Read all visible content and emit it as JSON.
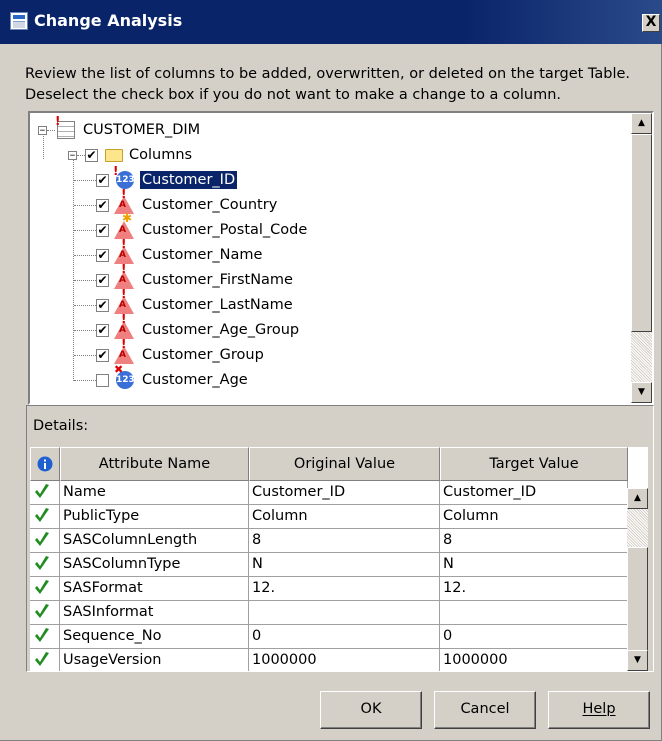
{
  "window": {
    "title": "Change Analysis",
    "close_glyph": "X"
  },
  "description": "Review the list of columns to be added, overwritten, or deleted on the target Table.  Deselect the check box if you do not want to make a change to a column.",
  "tree": {
    "root_label": "CUSTOMER_DIM",
    "folder_label": "Columns",
    "columns": [
      {
        "name": "Customer_ID",
        "checked": true,
        "icon": "numeric-column-icon",
        "badge": "modified",
        "selected": true
      },
      {
        "name": "Customer_Country",
        "checked": true,
        "icon": "character-column-icon",
        "badge": "modified",
        "selected": false
      },
      {
        "name": "Customer_Postal_Code",
        "checked": true,
        "icon": "character-column-icon",
        "badge": "added",
        "selected": false
      },
      {
        "name": "Customer_Name",
        "checked": true,
        "icon": "character-column-icon",
        "badge": "modified",
        "selected": false
      },
      {
        "name": "Customer_FirstName",
        "checked": true,
        "icon": "character-column-icon",
        "badge": "modified",
        "selected": false
      },
      {
        "name": "Customer_LastName",
        "checked": true,
        "icon": "character-column-icon",
        "badge": "modified",
        "selected": false
      },
      {
        "name": "Customer_Age_Group",
        "checked": true,
        "icon": "character-column-icon",
        "badge": "modified",
        "selected": false
      },
      {
        "name": "Customer_Group",
        "checked": true,
        "icon": "character-column-icon",
        "badge": "modified",
        "selected": false
      },
      {
        "name": "Customer_Age",
        "checked": false,
        "icon": "numeric-column-icon",
        "badge": "deleted",
        "selected": false
      }
    ]
  },
  "details": {
    "label": "Details:",
    "headers": {
      "attribute": "Attribute Name",
      "original": "Original Value",
      "target": "Target Value"
    },
    "rows": [
      {
        "attribute": "Name",
        "original": "Customer_ID",
        "target": "Customer_ID"
      },
      {
        "attribute": "PublicType",
        "original": "Column",
        "target": "Column"
      },
      {
        "attribute": "SASColumnLength",
        "original": "8",
        "target": "8"
      },
      {
        "attribute": "SASColumnType",
        "original": "N",
        "target": "N"
      },
      {
        "attribute": "SASFormat",
        "original": "12.",
        "target": "12."
      },
      {
        "attribute": "SASInformat",
        "original": "",
        "target": ""
      },
      {
        "attribute": "Sequence_No",
        "original": "0",
        "target": "0"
      },
      {
        "attribute": "UsageVersion",
        "original": "1000000",
        "target": "1000000"
      }
    ]
  },
  "buttons": {
    "ok": "OK",
    "cancel": "Cancel",
    "help": "Help"
  },
  "colors": {
    "title_bar": "#0a246a",
    "selection": "#0a246a",
    "check_green": "#1e8c1e",
    "info_blue": "#1f5fd0"
  }
}
